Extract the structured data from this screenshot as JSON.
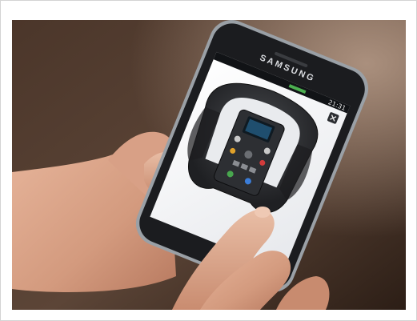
{
  "photo": {
    "device_brand": "SAMSUNG",
    "status_bar_time": "21:31",
    "screen_subject": "steering-wheel-3d-model",
    "colors": {
      "background_dark": "#3b2a1f",
      "background_light": "#8a7262",
      "phone_body": "#1b1c1f",
      "phone_bezel": "#9aa0a6",
      "screen": "#f4f5f7",
      "skin": "#d9a287",
      "wheel_grip": "#2a2b2e"
    }
  }
}
